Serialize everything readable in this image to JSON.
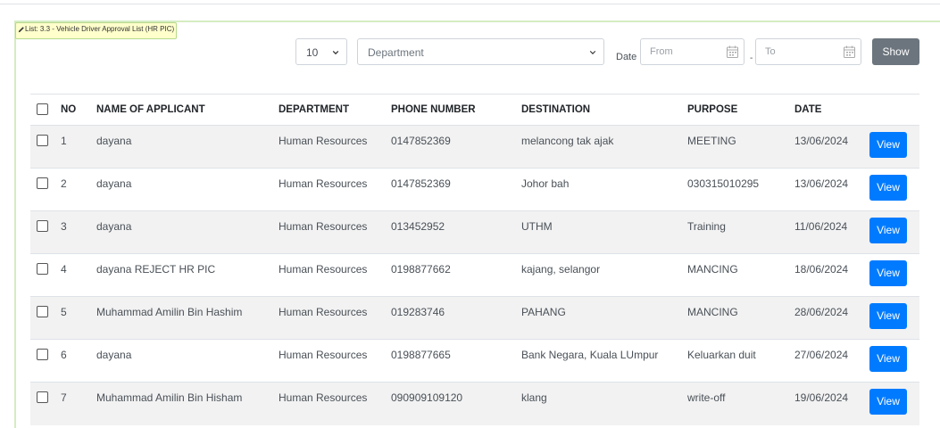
{
  "tag": {
    "label": "List: 3.3 - Vehicle Driver Approval List (HR PIC)",
    "icon": "pencil-icon"
  },
  "filters": {
    "page_length": "10",
    "department_placeholder": "Department",
    "date_label": "Date",
    "from_placeholder": "From",
    "separator": "-",
    "to_placeholder": "To",
    "show_label": "Show"
  },
  "table": {
    "headers": [
      "NO",
      "NAME OF APPLICANT",
      "DEPARTMENT",
      "PHONE NUMBER",
      "DESTINATION",
      "PURPOSE",
      "DATE"
    ],
    "view_label": "View",
    "rows": [
      {
        "no": "1",
        "name": "dayana",
        "dept": "Human Resources",
        "phone": "0147852369",
        "dest": "melancong tak ajak",
        "purpose": "MEETING",
        "date": "13/06/2024"
      },
      {
        "no": "2",
        "name": "dayana",
        "dept": "Human Resources",
        "phone": "0147852369",
        "dest": "Johor bah",
        "purpose": "030315010295",
        "date": "13/06/2024"
      },
      {
        "no": "3",
        "name": "dayana",
        "dept": "Human Resources",
        "phone": "013452952",
        "dest": "UTHM",
        "purpose": "Training",
        "date": "11/06/2024"
      },
      {
        "no": "4",
        "name": "dayana REJECT HR PIC",
        "dept": "Human Resources",
        "phone": "0198877662",
        "dest": "kajang, selangor",
        "purpose": "MANCING",
        "date": "18/06/2024"
      },
      {
        "no": "5",
        "name": "Muhammad Amilin Bin Hashim",
        "dept": "Human Resources",
        "phone": "019283746",
        "dest": "PAHANG",
        "purpose": "MANCING",
        "date": "28/06/2024"
      },
      {
        "no": "6",
        "name": "dayana",
        "dept": "Human Resources",
        "phone": "0198877665",
        "dest": "Bank Negara, Kuala LUmpur",
        "purpose": "Keluarkan duit",
        "date": "27/06/2024"
      },
      {
        "no": "7",
        "name": "Muhammad Amilin Bin Hisham",
        "dept": "Human Resources",
        "phone": "090909109120",
        "dest": "klang",
        "purpose": "write-off",
        "date": "19/06/2024"
      }
    ]
  },
  "colors": {
    "accent": "#007bff",
    "show_button": "#6c757d",
    "panel_border": "#d5ecc2",
    "tag_bg": "#ffffcc"
  }
}
